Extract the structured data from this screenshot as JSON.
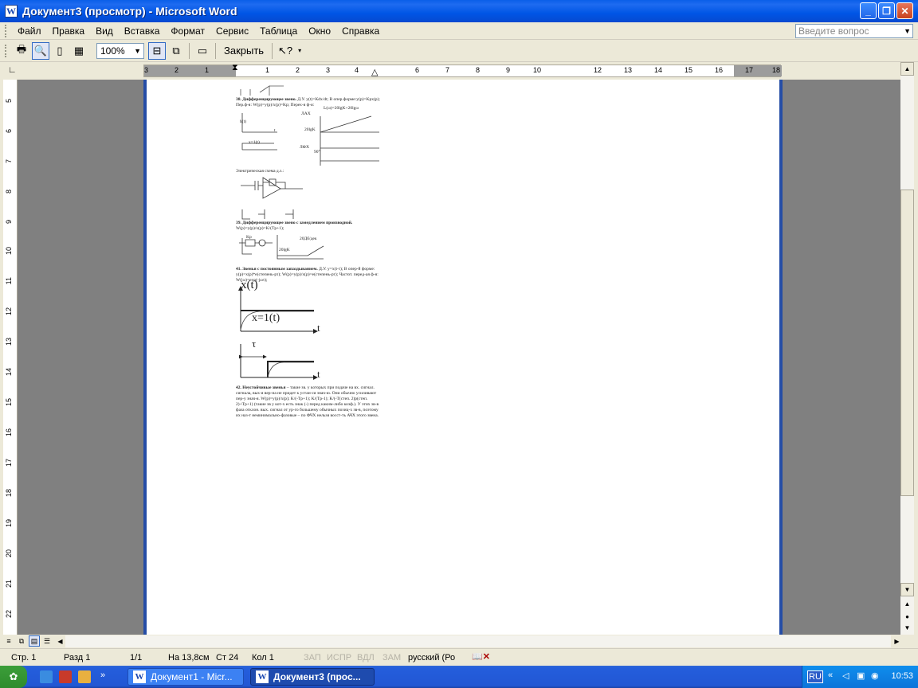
{
  "window": {
    "title": "Документ3 (просмотр) - Microsoft Word",
    "app_icon": "W"
  },
  "menu": {
    "items": [
      "Файл",
      "Правка",
      "Вид",
      "Вставка",
      "Формат",
      "Сервис",
      "Таблица",
      "Окно",
      "Справка"
    ],
    "help_placeholder": "Введите вопрос"
  },
  "toolbar": {
    "zoom": "100%",
    "close_label": "Закрыть"
  },
  "ruler": {
    "numbers": [
      "3",
      "2",
      "1",
      "1",
      "2",
      "3",
      "4",
      "6",
      "7",
      "8",
      "9",
      "10",
      "12",
      "13",
      "14",
      "15",
      "16",
      "17",
      "18"
    ]
  },
  "vruler": {
    "numbers": [
      "5",
      "6",
      "7",
      "8",
      "9",
      "10",
      "11",
      "12",
      "13",
      "14",
      "15",
      "16",
      "17",
      "18",
      "19",
      "20",
      "21",
      "22"
    ]
  },
  "document": {
    "item38_title": "38. Дифференцирующее звено.",
    "item38_text": "Д.У. y(t)=Kdx/dt; В опер.форме:y(p)=Kpx(p); Пер.ф-я: W(p)=y(p)/x(p)=Kp; Перех-я ф-я:",
    "fig1_ylabel": "h(t)",
    "fig1_xlabel": "t",
    "fig1_input": "x=1(t)",
    "lax_label": "ЛАХ",
    "lax_formula": "L(ω)=20lgK+20lgω",
    "lax_ytick": "20lgK",
    "lfx_label": "ЛФХ",
    "lfx_value": "90°",
    "circuit_label": "Электрическая схема д.з.:",
    "item39_title": "39. Дифференцирующее звено с замедлением производной.",
    "item39_text": "W(p)=y(p)/x(p)=K/(Tp+1);",
    "fig39_block": "Kp",
    "fig39_slope": "20Дб/дек",
    "fig39_level": "20lgK",
    "item41_title": "41. Звенья с постоянным запаздыванием.",
    "item41_text": "Д.У. y=x(t-τ); В опер-й форме: y(p)=x(p)*e(степень-pτ); W(p)=y(p)/x(p)=e(степень-pτ); Частот. перед-ая ф-я: W(jω)=exp(-jωτ);",
    "fig41_ylabel": "x(t)",
    "fig41_input": "x=1(t)",
    "fig41_t1": "t",
    "fig41_tau": "τ",
    "fig41_t2": "t",
    "item42_title": "42. Неустойчивые звенья",
    "item42_text": "– такие зв. у которых при подаче на вх. сигнал. сигнала, вых-я вер-на не придет к устан-ся знач-ю. Они обычно усиливают пер-у знач-я. W(p)=y(p)/x(p); K/(-Tp+1); K/(Tp-1); K/(-T(степ. 2)p(степ. 2)+Tp+1) (такие зв у кот-х есть знак (-) перед каким-либо коэф.). У этих зв-в фаза отклон. вых. сигнал от ур-го большему обычных позиц-х зв-в, поэтому их наз-т неминимально-фазовые – по ФЧХ нельзя восст-ть АЧХ этого звена."
  },
  "status": {
    "page": "Стр. 1",
    "section": "Разд 1",
    "pages": "1/1",
    "position": "На 13,8см",
    "line": "Ст 24",
    "col": "Кол 1",
    "rec": "ЗАП",
    "trk": "ИСПР",
    "ext": "ВДЛ",
    "ovr": "ЗАМ",
    "language": "русский (Ро"
  },
  "taskbar": {
    "tasks": [
      "Документ1 - Micr...",
      "Документ3 (прос..."
    ],
    "lang": "RU",
    "clock": "10:53"
  },
  "colors": {
    "title_bar": "#0A5FE8",
    "page_border": "#254DA6",
    "taskbar": "#245EDC",
    "chrome": "#ECE9D8"
  }
}
